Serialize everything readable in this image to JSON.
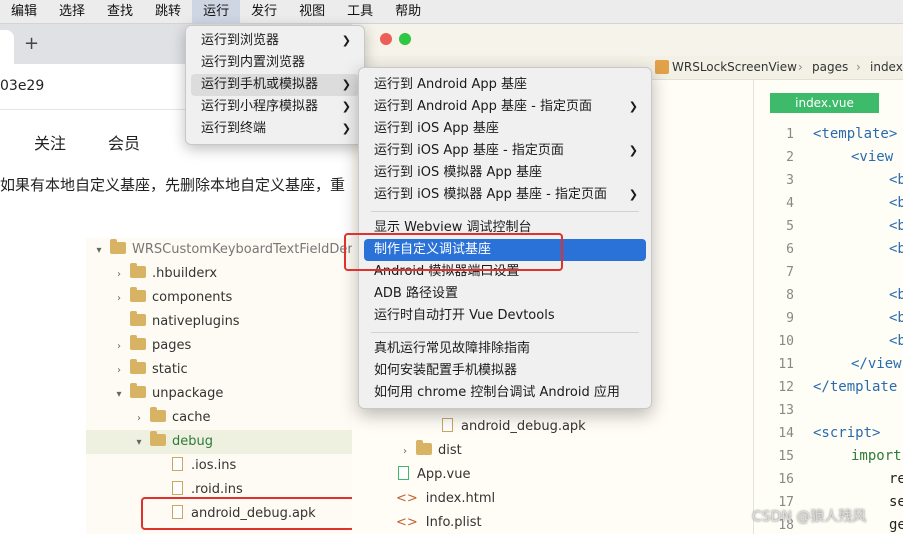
{
  "menubar": {
    "items": [
      "编辑",
      "选择",
      "查找",
      "跳转",
      "运行",
      "发行",
      "视图",
      "工具",
      "帮助"
    ],
    "active_index": 4
  },
  "browser": {
    "new_tab_symbol": "+",
    "url_fragment": "03e29",
    "nav": [
      "关注",
      "会员"
    ],
    "notice": "如果有本地自定义基座，先删除本地自定义基座，重"
  },
  "tree_left": {
    "project": "WRSCustomKeyboardTextFieldDem",
    "items": [
      ".hbuilderx",
      "components",
      "nativeplugins",
      "pages",
      "static",
      "unpackage",
      "cache",
      "debug",
      ".ios.ins",
      ".roid.ins",
      "android_debug.apk"
    ]
  },
  "hb": {
    "breadcrumb": [
      "WRSLockScreenView",
      "pages",
      "index"
    ],
    "file_tab": "index.vue",
    "tree_items": [
      "android_debug.apk",
      "dist",
      "App.vue",
      "index.html",
      "Info.plist"
    ]
  },
  "editor": {
    "lines": [
      "1",
      "2",
      "3",
      "4",
      "5",
      "6",
      "7",
      "8",
      "9",
      "10",
      "11",
      "12",
      "13",
      "14",
      "15",
      "16",
      "17",
      "18"
    ],
    "code": [
      "<template>",
      "<view",
      "<b",
      "<b",
      "<b",
      "<b",
      "<b",
      "<b",
      "<b",
      "</view",
      "</template",
      "<script>",
      "import",
      "re",
      "se",
      "ge"
    ]
  },
  "menu_run": {
    "items": [
      "运行到浏览器",
      "运行到内置浏览器",
      "运行到手机或模拟器",
      "运行到小程序模拟器",
      "运行到终端"
    ]
  },
  "menu_phone": {
    "items": [
      "运行到 Android App 基座",
      "运行到 Android App 基座 - 指定页面",
      "运行到 iOS App 基座",
      "运行到 iOS App 基座 - 指定页面",
      "运行到 iOS 模拟器 App 基座",
      "运行到 iOS 模拟器 App 基座 - 指定页面",
      "显示 Webview 调试控制台",
      "制作自定义调试基座",
      "Android 模拟器端口设置",
      "ADB 路径设置",
      "运行时自动打开 Vue Devtools",
      "真机运行常见故障排除指南",
      "如何安装配置手机模拟器",
      "如何用 chrome 控制台调试 Android 应用"
    ]
  },
  "watermark": "CSDN @狼人残风",
  "colors": {
    "highlight": "#2a72d8",
    "annotation_red": "#e0322c",
    "file_tab": "#3dba6a"
  }
}
